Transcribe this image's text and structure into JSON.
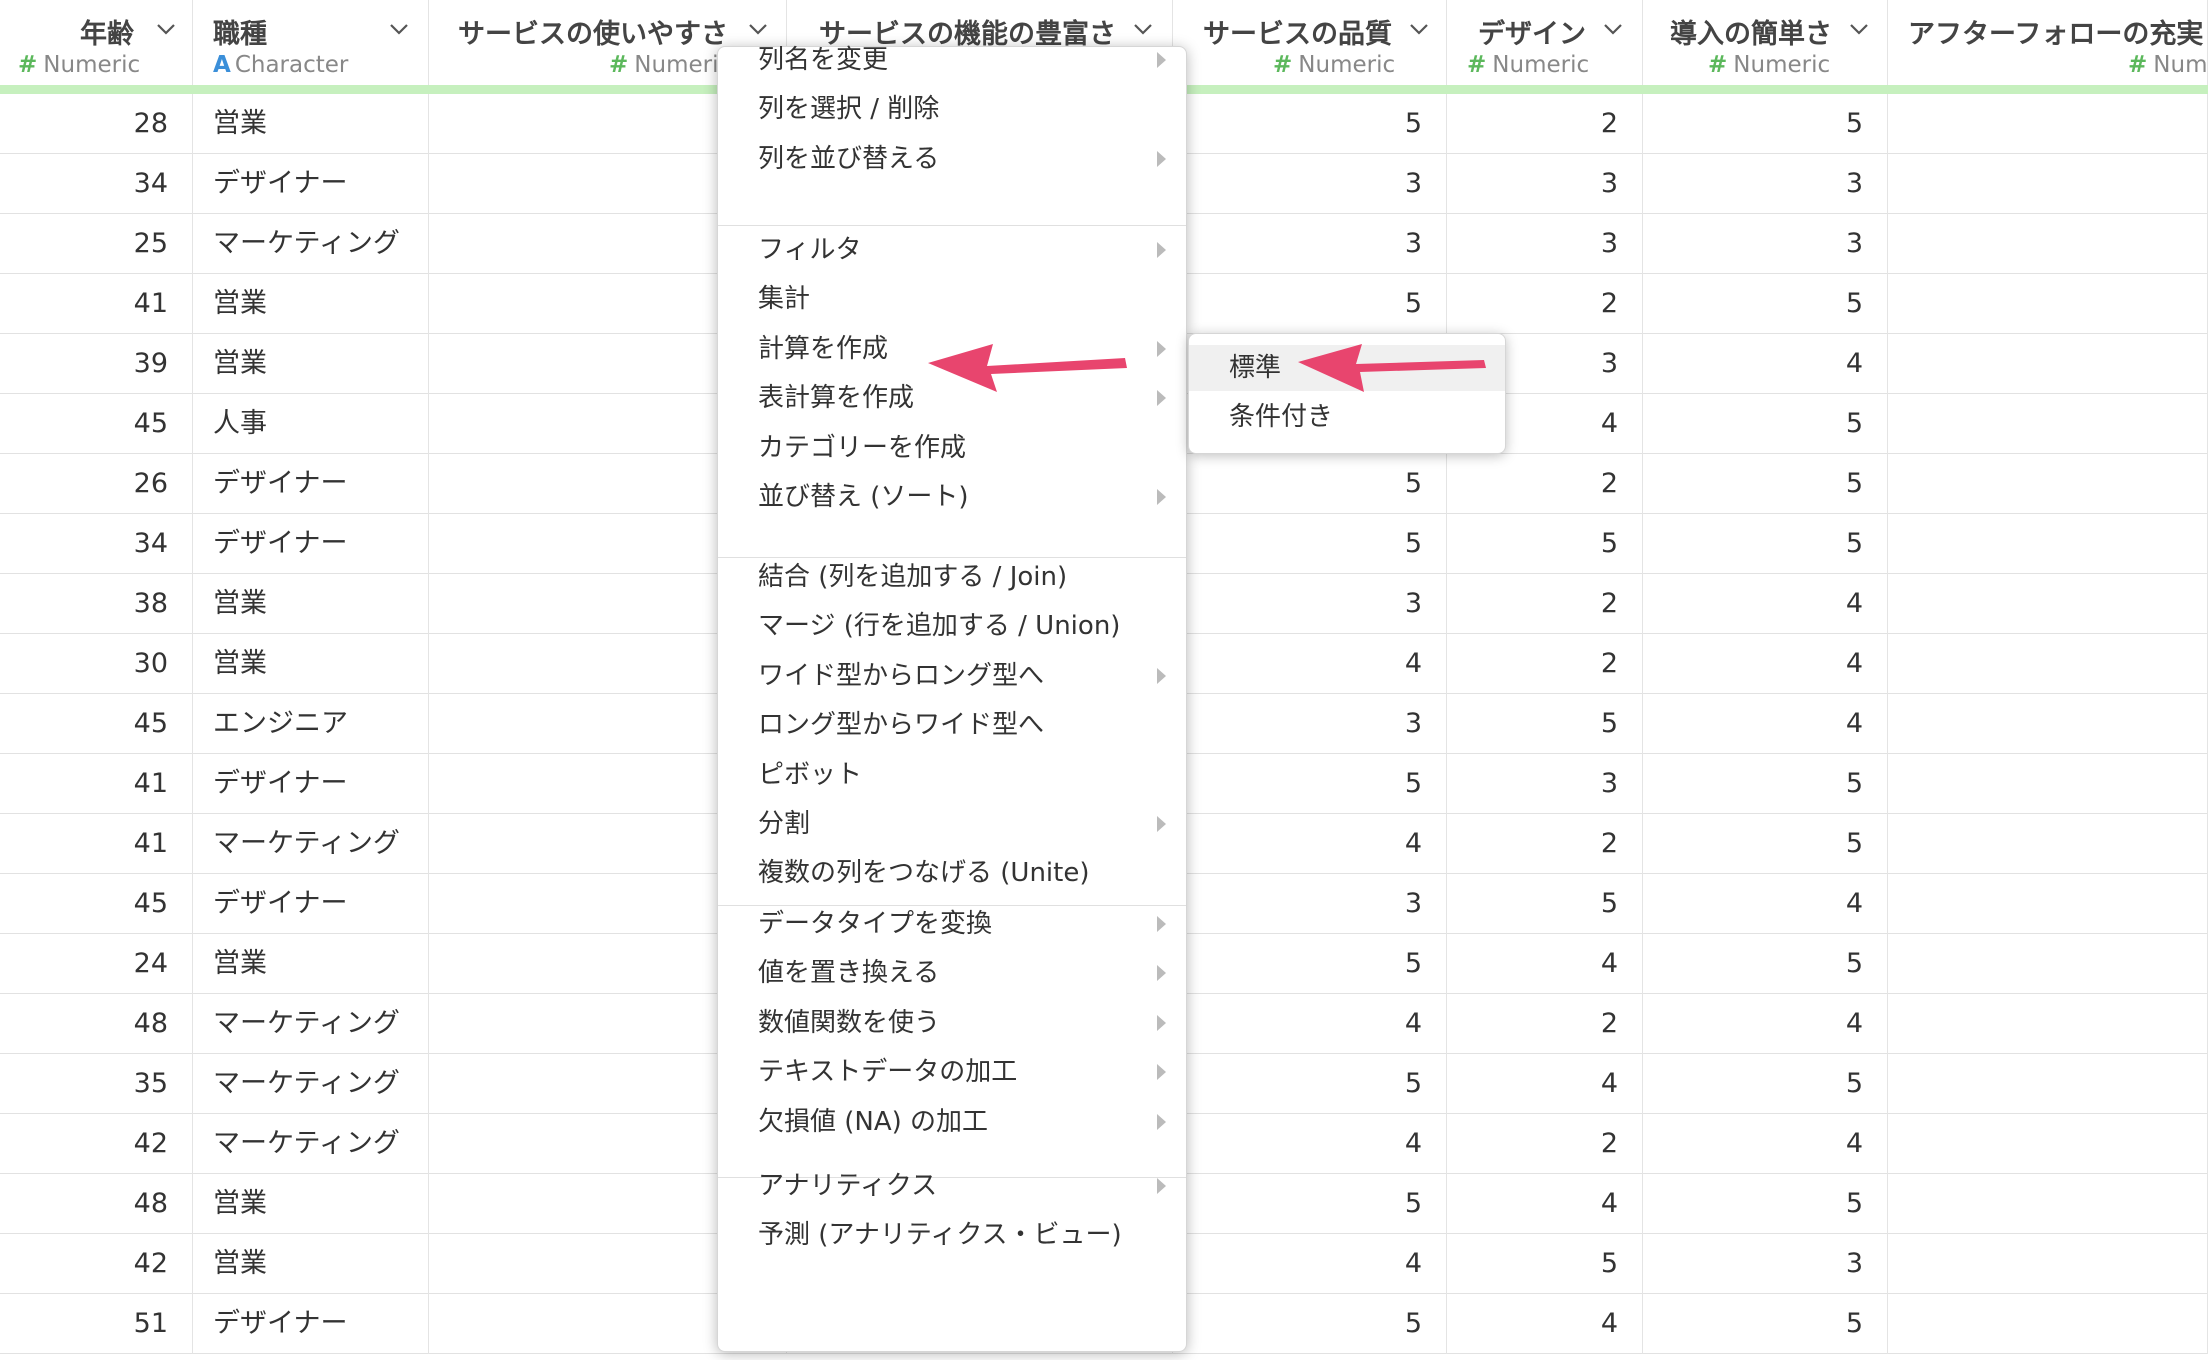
{
  "columns": [
    {
      "name": "年齢",
      "type": "Numeric",
      "type_symbol": "#"
    },
    {
      "name": "職種",
      "type": "Character",
      "type_symbol": "A"
    },
    {
      "name": "サービスの使いやすさ",
      "type": "Numeric",
      "type_symbol": "#"
    },
    {
      "name": "サービスの機能の豊富さ",
      "type": "",
      "type_symbol": ""
    },
    {
      "name": "サービスの品質",
      "type": "Numeric",
      "type_symbol": "#"
    },
    {
      "name": "デザイン",
      "type": "Numeric",
      "type_symbol": "#"
    },
    {
      "name": "導入の簡単さ",
      "type": "Numeric",
      "type_symbol": "#"
    },
    {
      "name": "アフターフォローの充実",
      "type": "Numeric",
      "type_symbol": "#"
    }
  ],
  "rows": [
    [
      "28",
      "営業",
      "5",
      "2",
      "5"
    ],
    [
      "34",
      "デザイナー",
      "3",
      "3",
      "3"
    ],
    [
      "25",
      "マーケティング",
      "3",
      "3",
      "3"
    ],
    [
      "41",
      "営業",
      "5",
      "2",
      "5"
    ],
    [
      "39",
      "営業",
      "",
      "3",
      "4"
    ],
    [
      "45",
      "人事",
      "",
      "4",
      "5"
    ],
    [
      "26",
      "デザイナー",
      "5",
      "2",
      "5"
    ],
    [
      "34",
      "デザイナー",
      "5",
      "5",
      "5"
    ],
    [
      "38",
      "営業",
      "3",
      "2",
      "4"
    ],
    [
      "30",
      "営業",
      "4",
      "2",
      "4"
    ],
    [
      "45",
      "エンジニア",
      "3",
      "5",
      "4"
    ],
    [
      "41",
      "デザイナー",
      "5",
      "3",
      "5"
    ],
    [
      "41",
      "マーケティング",
      "4",
      "2",
      "5"
    ],
    [
      "45",
      "デザイナー",
      "3",
      "5",
      "4"
    ],
    [
      "24",
      "営業",
      "5",
      "4",
      "5"
    ],
    [
      "48",
      "マーケティング",
      "4",
      "2",
      "4"
    ],
    [
      "35",
      "マーケティング",
      "5",
      "4",
      "5"
    ],
    [
      "42",
      "マーケティング",
      "4",
      "2",
      "4"
    ],
    [
      "48",
      "営業",
      "5",
      "4",
      "5"
    ],
    [
      "42",
      "営業",
      "4",
      "5",
      "3"
    ],
    [
      "51",
      "デザイナー",
      "5",
      "4",
      "5"
    ]
  ],
  "menu": {
    "groups": [
      [
        {
          "label": "列名を変更",
          "submenu": true
        },
        {
          "label": "列を選択 / 削除",
          "submenu": false
        },
        {
          "label": "列を並び替える",
          "submenu": true
        }
      ],
      [
        {
          "label": "フィルタ",
          "submenu": true
        },
        {
          "label": "集計",
          "submenu": false
        },
        {
          "label": "計算を作成",
          "submenu": true
        },
        {
          "label": "表計算を作成",
          "submenu": true
        },
        {
          "label": "カテゴリーを作成",
          "submenu": false
        },
        {
          "label": "並び替え (ソート)",
          "submenu": true
        }
      ],
      [
        {
          "label": "結合 (列を追加する / Join)",
          "submenu": false
        },
        {
          "label": "マージ (行を追加する / Union)",
          "submenu": false
        },
        {
          "label": "ワイド型からロング型へ",
          "submenu": true
        },
        {
          "label": "ロング型からワイド型へ",
          "submenu": false
        },
        {
          "label": "ピボット",
          "submenu": false
        },
        {
          "label": "分割",
          "submenu": true
        },
        {
          "label": "複数の列をつなげる (Unite)",
          "submenu": false
        }
      ],
      [
        {
          "label": "データタイプを変換",
          "submenu": true
        },
        {
          "label": "値を置き換える",
          "submenu": true
        },
        {
          "label": "数値関数を使う",
          "submenu": true
        },
        {
          "label": "テキストデータの加工",
          "submenu": true
        },
        {
          "label": "欠損値 (NA) の加工",
          "submenu": true
        }
      ],
      [
        {
          "label": "アナリティクス",
          "submenu": true
        },
        {
          "label": "予測 (アナリティクス・ビュー)",
          "submenu": false
        }
      ]
    ]
  },
  "submenu": {
    "items": [
      {
        "label": "標準",
        "active": true
      },
      {
        "label": "条件付き",
        "active": false
      }
    ]
  },
  "colors": {
    "accent_arrow": "#e8456e",
    "header_bar": "#c6f0be",
    "numeric_icon": "#5cb85c",
    "character_icon": "#3b8fd9"
  }
}
